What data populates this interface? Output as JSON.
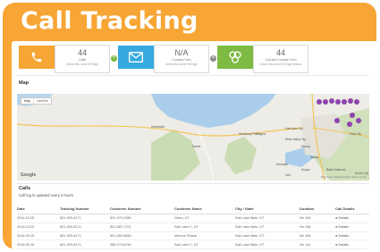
{
  "page": {
    "title": "Call Tracking"
  },
  "stats": [
    {
      "value": "44",
      "label": "Calls",
      "sub": "Green this Level 90 Edge"
    },
    {
      "value": "N/A",
      "label": "Contact Form",
      "sub": "Green this Level 90 Edge"
    },
    {
      "value": "44",
      "label": "Call and Contact Form",
      "sub": "Green this Level 90 Edge Visitors"
    }
  ],
  "map_section": {
    "title": "Map",
    "toggle": [
      "Map",
      "Satellite"
    ],
    "place_labels": [
      "Salt Lake City",
      "Stansbury Park",
      "Tooele",
      "Grantsville",
      "Magna",
      "West Valley City",
      "Murray",
      "Sandy",
      "Draper",
      "Lehi",
      "Herriman",
      "Black Diamond",
      "Park City",
      "Heber City"
    ],
    "attribution": "Map data ©2019 Google  Terms of Use",
    "logo": "Google"
  },
  "calls": {
    "title": "Calls",
    "subtitle": "Call log is updated every 2 hours",
    "columns": [
      "Date",
      "Tracking Number",
      "Customer Number",
      "Customer Name",
      "City / State",
      "Duration",
      "Call Details"
    ],
    "rows": [
      {
        "date": "2016-10-05",
        "tracking": "801-900-8171",
        "customer": "801-979-2286",
        "name": "Orem, UT",
        "city": "Salt Lake Main, UT",
        "duration": "0m 32s",
        "details": "● Details"
      },
      {
        "date": "2016-10-02",
        "tracking": "801-900-8171",
        "customer": "801-587-1701",
        "name": "Salt Lake C, UT",
        "city": "Salt Lake Main, UT",
        "duration": "0m 28s",
        "details": "● Details"
      },
      {
        "date": "2016-09-25",
        "tracking": "801-900-8171",
        "customer": "801-590-8084",
        "name": "Monroe Shane",
        "city": "Salt Lake Main, UT",
        "duration": "0m 45s",
        "details": "● Details"
      },
      {
        "date": "2016-09-16",
        "tracking": "801-900-8171",
        "customer": "385-273-8748",
        "name": "Salt Lake C, UT",
        "city": "Salt Lake Main, UT",
        "duration": "0m 11s",
        "details": "● Details"
      }
    ]
  },
  "colors": {
    "frame": "#f7a534",
    "phone": "#f7a534",
    "email": "#36a9e1",
    "combo": "#7dbb42",
    "marker": "#8e44ad"
  }
}
